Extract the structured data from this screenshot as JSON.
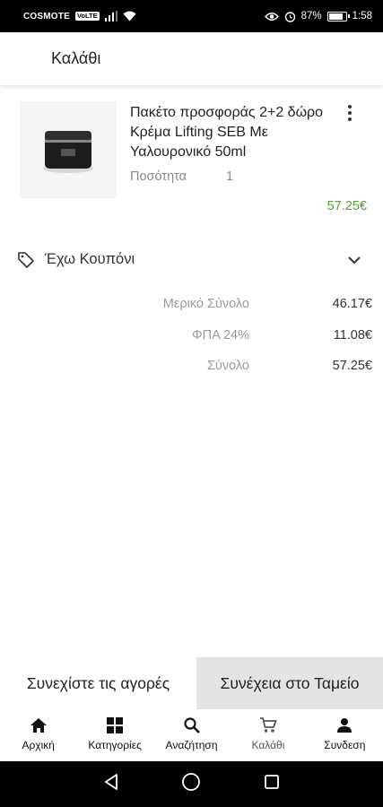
{
  "status_bar": {
    "carrier": "COSMOTE",
    "network_badge": "VoLTE",
    "battery_percent": "87%",
    "battery_level": 0.87,
    "time": "1:58"
  },
  "app_bar": {
    "title": "Καλάθι"
  },
  "cart": {
    "items": [
      {
        "title": "Πακέτο προσφοράς 2+2 δώρο Κρέμα Lifting SEB Με Υαλουρονικό 50ml",
        "quantity_label": "Ποσότητα",
        "quantity": "1",
        "price": "57.25€"
      }
    ]
  },
  "coupon": {
    "label": "Έχω Κουπόνι"
  },
  "summary": {
    "subtotal_label": "Μερικό Σύνολο",
    "subtotal_value": "46.17€",
    "vat_label": "ΦΠΑ 24%",
    "vat_value": "11.08€",
    "total_label": "Σύνολο",
    "total_value": "57.25€"
  },
  "actions": {
    "continue_shopping": "Συνεχίστε τις αγορές",
    "checkout": "Συνέχεια στο Ταμείο"
  },
  "bottom_nav": [
    {
      "label": "Αρχική",
      "icon": "home-icon"
    },
    {
      "label": "Κατηγορίες",
      "icon": "grid-icon"
    },
    {
      "label": "Αναζήτηση",
      "icon": "search-icon"
    },
    {
      "label": "Καλάθι",
      "icon": "cart-icon"
    },
    {
      "label": "Συνδεση",
      "icon": "person-icon"
    }
  ],
  "colors": {
    "price_green": "#5a9b39",
    "checkout_bg": "#e4e4e4",
    "system_bar": "#000000"
  }
}
